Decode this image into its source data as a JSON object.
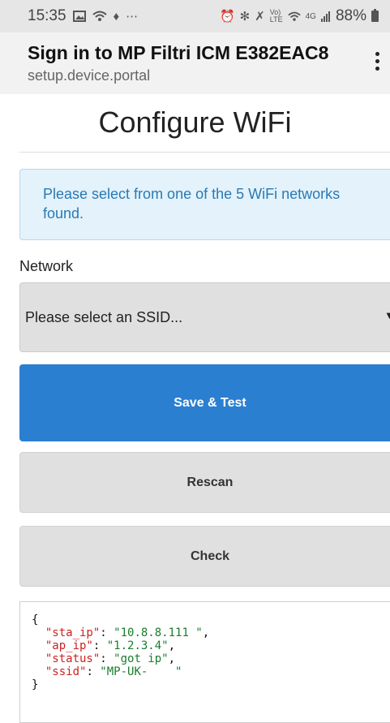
{
  "status_bar": {
    "time": "15:35",
    "battery": "88%",
    "signal": "4G",
    "icons_left": [
      "image-icon",
      "wifi-icon",
      "notification-icon",
      "more-icon"
    ],
    "icons_right": [
      "alarm-icon",
      "bluetooth-icon",
      "mute-icon",
      "volte-icon",
      "wifi-icon",
      "signal-icon",
      "battery-icon"
    ]
  },
  "portal": {
    "title": "Sign in to MP Filtri ICM E382EAC8",
    "url": "setup.device.portal"
  },
  "page": {
    "title": "Configure WiFi",
    "alert": "Please select from one of the 5 WiFi networks found.",
    "network_label": "Network",
    "select_value": "Please select an SSID...",
    "save_label": "Save & Test",
    "rescan_label": "Rescan",
    "check_label": "Check"
  },
  "status_json": {
    "open": "{",
    "close": "}",
    "rows": [
      {
        "key": "\"sta_ip\"",
        "value": "\"10.8.8.111 \"",
        "sep": ","
      },
      {
        "key": "\"ap_ip\"",
        "value": "\"1.2.3.4\"",
        "sep": ","
      },
      {
        "key": "\"status\"",
        "value": "\"got ip\"",
        "sep": ","
      },
      {
        "key": "\"ssid\"",
        "value": "\"MP-UK-    \"",
        "sep": ""
      }
    ]
  },
  "colors": {
    "primary": "#2b7fd1",
    "alert_bg": "#e3f2fb",
    "alert_text": "#2b79b3",
    "json_key": "#cc2222",
    "json_string": "#1a7d2d"
  }
}
